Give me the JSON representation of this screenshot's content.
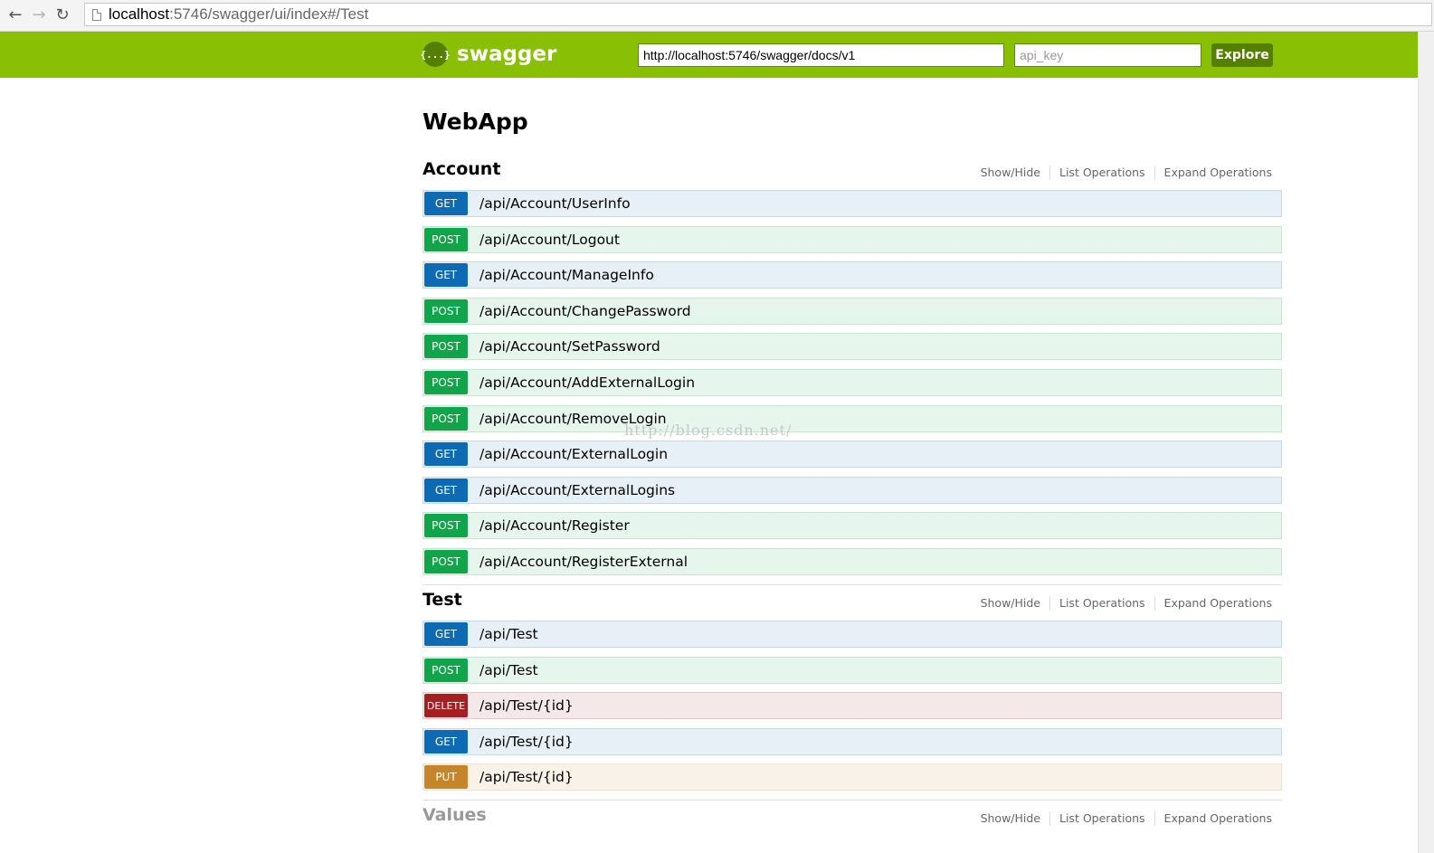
{
  "browser": {
    "back_icon": "back-arrow-icon",
    "forward_icon": "forward-arrow-icon",
    "reload_icon": "reload-icon",
    "url_host": "localhost",
    "url_rest": ":5746/swagger/ui/index#/Test"
  },
  "header": {
    "logo_glyph": "{...}",
    "logo_text": "swagger",
    "docs_url": "http://localhost:5746/swagger/docs/v1",
    "api_key_placeholder": "api_key",
    "explore_label": "Explore",
    "brand_color": "#89bf04"
  },
  "api_title": "WebApp",
  "watermark": "http://blog.csdn.net/",
  "resource_links": [
    "Show/Hide",
    "List Operations",
    "Expand Operations"
  ],
  "resources": [
    {
      "name": "Account",
      "operations": [
        {
          "method": "GET",
          "path": "/api/Account/UserInfo"
        },
        {
          "method": "POST",
          "path": "/api/Account/Logout"
        },
        {
          "method": "GET",
          "path": "/api/Account/ManageInfo"
        },
        {
          "method": "POST",
          "path": "/api/Account/ChangePassword"
        },
        {
          "method": "POST",
          "path": "/api/Account/SetPassword"
        },
        {
          "method": "POST",
          "path": "/api/Account/AddExternalLogin"
        },
        {
          "method": "POST",
          "path": "/api/Account/RemoveLogin"
        },
        {
          "method": "GET",
          "path": "/api/Account/ExternalLogin"
        },
        {
          "method": "GET",
          "path": "/api/Account/ExternalLogins"
        },
        {
          "method": "POST",
          "path": "/api/Account/Register"
        },
        {
          "method": "POST",
          "path": "/api/Account/RegisterExternal"
        }
      ]
    },
    {
      "name": "Test",
      "operations": [
        {
          "method": "GET",
          "path": "/api/Test"
        },
        {
          "method": "POST",
          "path": "/api/Test"
        },
        {
          "method": "DELETE",
          "path": "/api/Test/{id}"
        },
        {
          "method": "GET",
          "path": "/api/Test/{id}"
        },
        {
          "method": "PUT",
          "path": "/api/Test/{id}"
        }
      ]
    },
    {
      "name": "Values",
      "operations": []
    }
  ]
}
